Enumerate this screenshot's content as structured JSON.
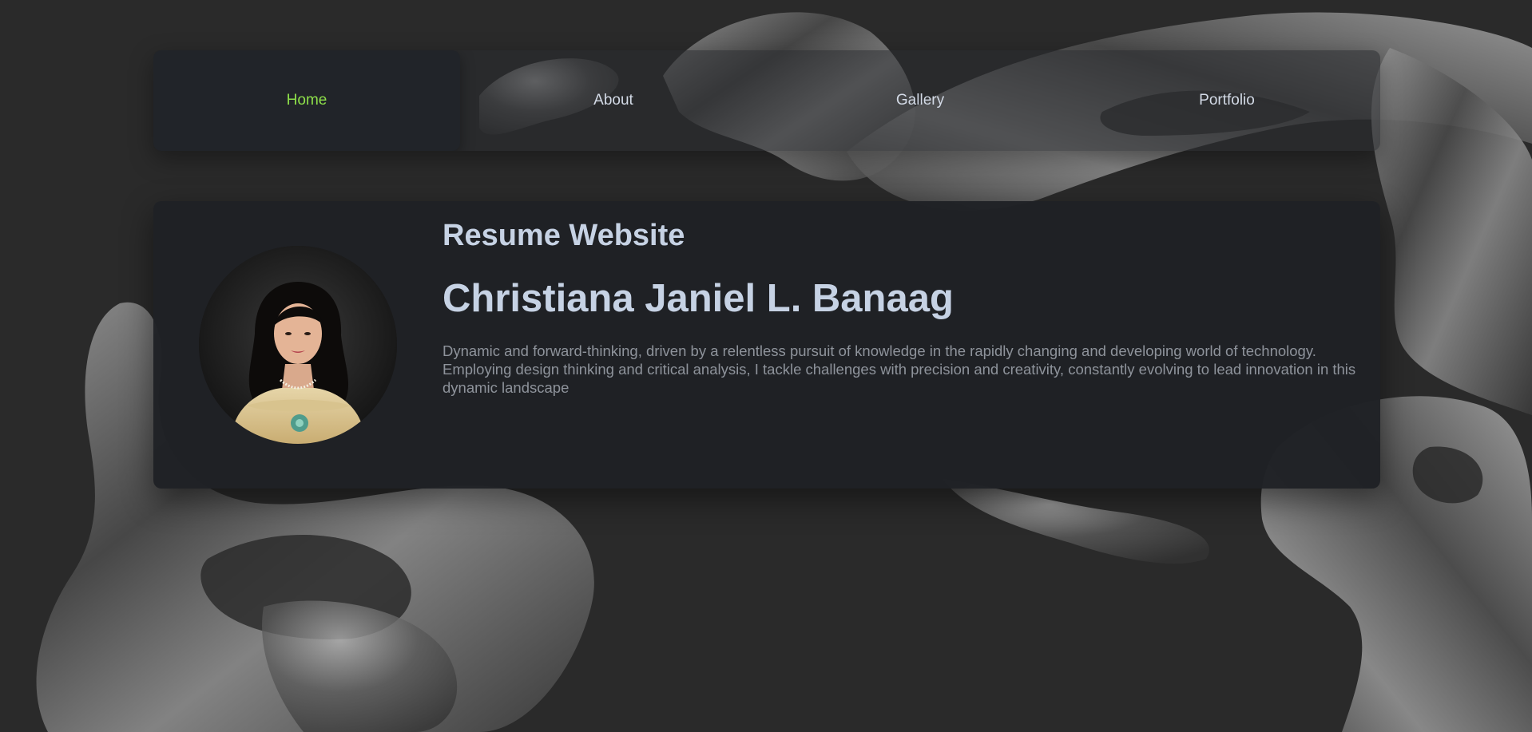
{
  "nav": {
    "items": [
      {
        "label": "Home",
        "active": true
      },
      {
        "label": "About",
        "active": false
      },
      {
        "label": "Gallery",
        "active": false
      },
      {
        "label": "Portfolio",
        "active": false
      }
    ]
  },
  "hero": {
    "site_title": "Resume Website",
    "name": "Christiana Janiel L. Banaag",
    "bio": "Dynamic and forward-thinking, driven by a relentless pursuit of knowledge in the rapidly changing and developing world of technology. Employing design thinking and critical analysis, I tackle challenges with precision and creativity, constantly evolving to lead innovation in this dynamic landscape"
  },
  "colors": {
    "background": "#2a2a2a",
    "active_nav_text": "#8ee04a",
    "nav_text": "#d3dae6",
    "heading_text": "#c6d2e4",
    "body_text": "#8e939b",
    "card_background": "#1f2125"
  }
}
